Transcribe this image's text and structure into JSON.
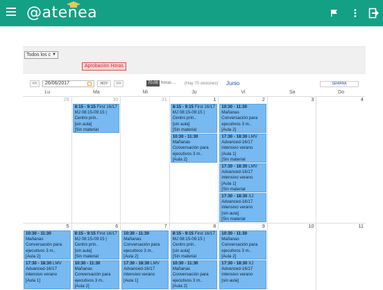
{
  "header": {
    "logo_text": "@atenea"
  },
  "filter": {
    "selected": "Todos los c"
  },
  "aprobacion_label": "Aprobación Horas",
  "toolbar": {
    "prev": "<<",
    "date_value": "26/06/2017",
    "hoy_label": "HOY",
    "next": ">>",
    "hours_value": "70.00",
    "hours_label": "horas",
    "hours_ellipsis": "...",
    "sessions": "(Hay 70 sesiones)",
    "month": "Junio",
    "semana_label": "SEMANA"
  },
  "weekdays": [
    "Lu",
    "Ma",
    "Mi",
    "Ju",
    "Vi",
    "Sa",
    "Do"
  ],
  "weeks": [
    {
      "days": [
        {
          "num": "29",
          "other": true,
          "events": []
        },
        {
          "num": "30",
          "other": true,
          "events": [
            {
              "time": "8:15 - 9:15",
              "lines": [
                " First 16/17",
                "MJ 08:15-09:15 | Centro prin..",
                "[sin aula]",
                "[Sin material asignado]"
              ]
            }
          ]
        },
        {
          "num": "31",
          "other": true,
          "events": []
        },
        {
          "num": "1",
          "other": false,
          "events": [
            {
              "time": "8:15 - 9:15",
              "lines": [
                " First 16/17",
                "MJ 08:15-09:15 | Centro prin..",
                "[sin aula]",
                "[Sin material asignado]"
              ]
            },
            {
              "time": "10:30 - 11:30",
              "lines": [
                " Mañanas",
                "Conversación para ejecutivos 3 m..",
                "[Aula 2]",
                "[Sin material asignado]"
              ]
            }
          ]
        },
        {
          "num": "2",
          "other": false,
          "events": [
            {
              "time": "10:30 - 11:30",
              "lines": [
                " Mañanas",
                "Conversación para ejecutivos 3 m..",
                "[Aula 2]",
                "[Sin material asignado]"
              ]
            },
            {
              "time": "17:30 - 18:30",
              "lines": [
                " LMV",
                "Advanced-16/17",
                "intensivo verano",
                "[Aula 1]",
                "[Sin material asignado]"
              ]
            },
            {
              "time": "17:30 - 18:30",
              "lines": [
                " LMV",
                "Advanced-16/17",
                "intensivo verano",
                "[Aula 1]",
                "[Sin material asignado]"
              ]
            },
            {
              "time": "17:30 - 18:30",
              "lines": [
                " XJ",
                "Advanced-16/17",
                "intensivo verano",
                "[sin aula]",
                "[Sin material asignado]"
              ]
            }
          ]
        },
        {
          "num": "3",
          "other": false,
          "events": []
        },
        {
          "num": "4",
          "other": false,
          "events": []
        }
      ]
    },
    {
      "days": [
        {
          "num": "5",
          "other": false,
          "events": [
            {
              "time": "10:30 - 11:30",
              "lines": [
                " Mañanas",
                "Conversación para ejecutivos 3 m..",
                "[Aula 2]",
                "[Sin material asignado]"
              ]
            },
            {
              "time": "17:30 - 18:30",
              "lines": [
                " LMV",
                "Advanced-16/17",
                "intensivo verano",
                "[Aula 1]"
              ]
            }
          ]
        },
        {
          "num": "6",
          "other": false,
          "events": [
            {
              "time": "8:15 - 9:15",
              "lines": [
                " First 16/17",
                "MJ 08:15-09:15 | Centro prin..",
                "[sin aula]",
                "[Sin material asignado]"
              ]
            },
            {
              "time": "10:30 - 11:30",
              "lines": [
                " Mañanas",
                "Conversación para ejecutivos 3 m..",
                "[Aula 2]"
              ]
            }
          ]
        },
        {
          "num": "7",
          "other": false,
          "events": [
            {
              "time": "10:30 - 11:30",
              "lines": [
                " Mañanas",
                "Conversación para ejecutivos 3 m..",
                "[Aula 2]",
                "[Sin material asignado]"
              ]
            },
            {
              "time": "17:30 - 18:30",
              "lines": [
                " LMV",
                "Advanced-16/17",
                "intensivo verano",
                "[Aula 1]"
              ]
            }
          ]
        },
        {
          "num": "8",
          "other": false,
          "events": [
            {
              "time": "8:15 - 9:15",
              "lines": [
                " First 16/17",
                "MJ 08:15-09:15 | Centro prin..",
                "[sin aula]",
                "[Sin material asignado]"
              ]
            },
            {
              "time": "10:30 - 11:30",
              "lines": [
                " Mañanas",
                "Conversación para ejecutivos 3 m..",
                "[Aula 2]"
              ]
            }
          ]
        },
        {
          "num": "9",
          "other": false,
          "events": [
            {
              "time": "10:30 - 11:30",
              "lines": [
                " Mañanas",
                "Conversación para ejecutivos 3 m..",
                "[Aula 2]",
                "[Sin material asignado]"
              ]
            },
            {
              "time": "17:30 - 18:30",
              "lines": [
                " XJ",
                "Advanced-16/17",
                "intensivo verano",
                "[sin aula]"
              ]
            }
          ]
        },
        {
          "num": "10",
          "other": false,
          "events": []
        },
        {
          "num": "11",
          "other": false,
          "events": []
        }
      ]
    }
  ]
}
